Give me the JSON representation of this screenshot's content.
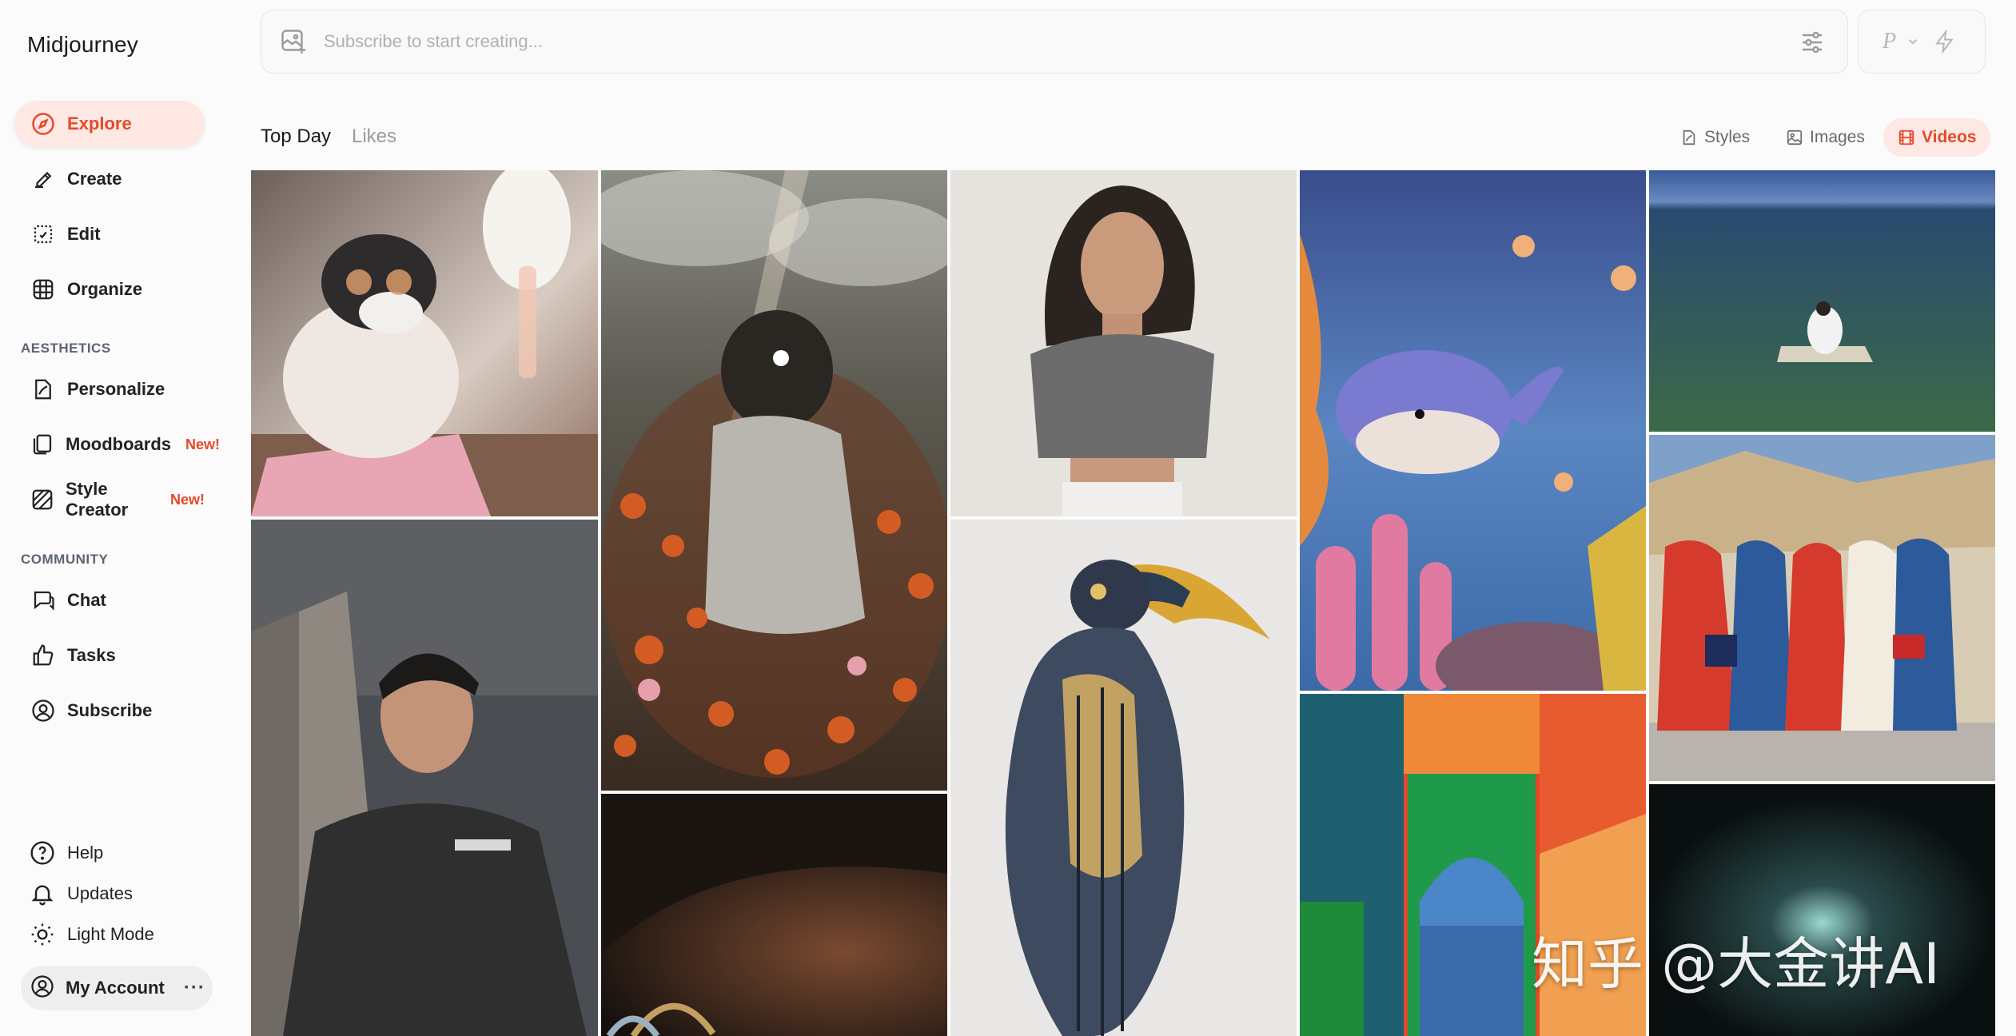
{
  "app": {
    "name": "Midjourney"
  },
  "sidebar": {
    "main": [
      {
        "label": "Explore",
        "icon": "compass-icon",
        "active": true
      },
      {
        "label": "Create",
        "icon": "brush-icon"
      },
      {
        "label": "Edit",
        "icon": "edit-icon"
      },
      {
        "label": "Organize",
        "icon": "grid-icon"
      }
    ],
    "aesthetics_heading": "AESTHETICS",
    "aesthetics": [
      {
        "label": "Personalize",
        "icon": "personalize-icon"
      },
      {
        "label": "Moodboards",
        "icon": "moodboard-icon",
        "badge": "New!"
      },
      {
        "label": "Style Creator",
        "icon": "style-creator-icon",
        "badge": "New!"
      }
    ],
    "community_heading": "COMMUNITY",
    "community": [
      {
        "label": "Chat",
        "icon": "chat-icon"
      },
      {
        "label": "Tasks",
        "icon": "thumbs-up-icon"
      },
      {
        "label": "Subscribe",
        "icon": "user-circle-icon"
      }
    ],
    "footer": [
      {
        "label": "Help",
        "icon": "help-icon"
      },
      {
        "label": "Updates",
        "icon": "bell-icon"
      },
      {
        "label": "Light Mode",
        "icon": "sun-icon"
      }
    ],
    "account": {
      "label": "My Account",
      "more": "···"
    }
  },
  "prompt": {
    "placeholder": "Subscribe to start creating..."
  },
  "mode": {
    "label": "P"
  },
  "tabs": [
    {
      "label": "Top Day",
      "active": true
    },
    {
      "label": "Likes",
      "active": false
    }
  ],
  "filters": [
    {
      "label": "Styles",
      "active": false
    },
    {
      "label": "Images",
      "active": false
    },
    {
      "label": "Videos",
      "active": true
    }
  ],
  "gallery": [
    {
      "name": "cat-on-airplane"
    },
    {
      "name": "astronaut-in-flowers"
    },
    {
      "name": "woman-portrait"
    },
    {
      "name": "felt-whale"
    },
    {
      "name": "ocean-raft"
    },
    {
      "name": "man-hoodie"
    },
    {
      "name": "hand-rings"
    },
    {
      "name": "toucan-forest"
    },
    {
      "name": "women-walking-street"
    },
    {
      "name": "abstract-arch-painting"
    },
    {
      "name": "dark-night-scene"
    }
  ],
  "watermark": "知乎 @大金讲AI",
  "colors": {
    "accent": "#e54a2c",
    "accent_bg": "#fde8e4"
  }
}
